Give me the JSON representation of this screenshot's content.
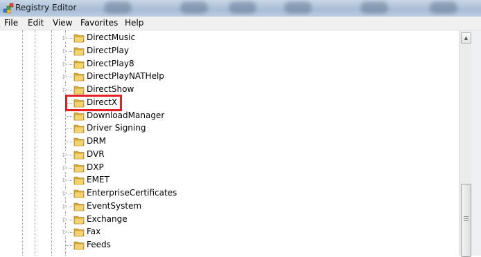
{
  "window": {
    "title": "Registry Editor"
  },
  "menu": [
    "File",
    "Edit",
    "View",
    "Favorites",
    "Help"
  ],
  "tree": {
    "items": [
      {
        "label": "DirectMusic",
        "expandable": true
      },
      {
        "label": "DirectPlay",
        "expandable": true
      },
      {
        "label": "DirectPlay8",
        "expandable": true
      },
      {
        "label": "DirectPlayNATHelp",
        "expandable": true
      },
      {
        "label": "DirectShow",
        "expandable": true
      },
      {
        "label": "DirectX",
        "expandable": false,
        "highlighted": true
      },
      {
        "label": "DownloadManager",
        "expandable": false
      },
      {
        "label": "Driver Signing",
        "expandable": false
      },
      {
        "label": "DRM",
        "expandable": false
      },
      {
        "label": "DVR",
        "expandable": true
      },
      {
        "label": "DXP",
        "expandable": true
      },
      {
        "label": "EMET",
        "expandable": true
      },
      {
        "label": "EnterpriseCertificates",
        "expandable": true
      },
      {
        "label": "EventSystem",
        "expandable": true
      },
      {
        "label": "Exchange",
        "expandable": true
      },
      {
        "label": "Fax",
        "expandable": true
      },
      {
        "label": "Feeds",
        "expandable": false
      }
    ]
  },
  "colors": {
    "highlight_border": "#e32025",
    "folder": "#e8c15a"
  },
  "icons": {
    "app": "registry-editor-icon",
    "folder": "folder-icon",
    "expander": "triangle-right-icon"
  }
}
